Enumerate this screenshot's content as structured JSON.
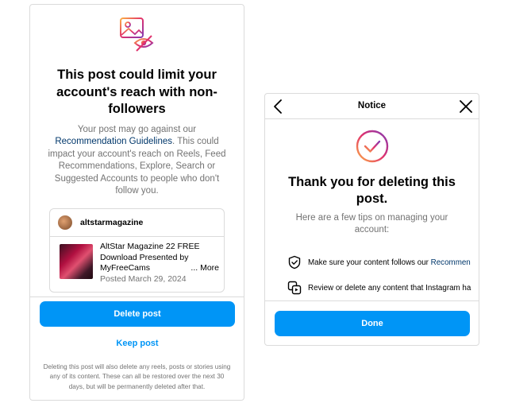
{
  "left_dialog": {
    "title": "This post could limit your account's reach with non-followers",
    "description_before": "Your post may go against our ",
    "description_link": "Recommendation Guidelines",
    "description_after": ". This could impact your account's reach on Reels, Feed Recommendations, Explore, Search or Suggested Accounts to people who don't follow you.",
    "post": {
      "username": "altstarmagazine",
      "caption_line1": "AltStar Magazine 22 FREE",
      "caption_line2": "Download Presented by",
      "caption_line3": "MyFreeCams",
      "more_label": "... More",
      "date": "Posted March 29, 2024"
    },
    "delete_label": "Delete post",
    "keep_label": "Keep post",
    "footnote": "Deleting this post will also delete any reels, posts or stories using any of its content. These can all be restored over the next 30 days, but will be permanently deleted after that."
  },
  "right_dialog": {
    "header_title": "Notice",
    "title": "Thank you for deleting this post.",
    "subtitle": "Here are a few tips on managing your account:",
    "tips": [
      {
        "text": "Make sure your content follows our ",
        "link": "Recommen",
        "icon": "shield-check-icon"
      },
      {
        "text": "Review or delete any content that Instagram ha",
        "link": "",
        "icon": "media-review-icon"
      }
    ],
    "done_label": "Done"
  },
  "colors": {
    "primary_button": "#0095f6",
    "link": "#00376b",
    "secondary_text": "#737373",
    "border": "#dbdbdb"
  }
}
